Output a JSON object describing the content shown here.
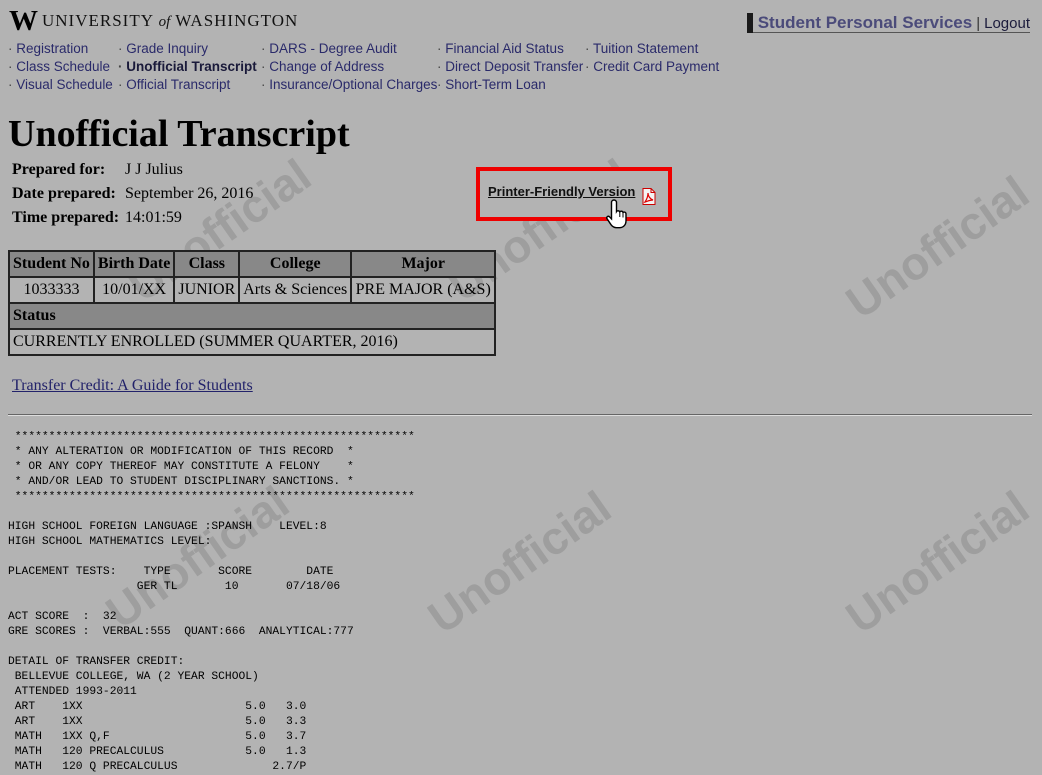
{
  "header": {
    "logo_letter": "W",
    "logo_text_1": "UNIVERSITY",
    "logo_text_of": "of",
    "logo_text_2": "WASHINGTON",
    "app_title": "Student Personal Services",
    "separator": "|",
    "logout_label": "Logout"
  },
  "nav": {
    "col1": [
      "Registration",
      "Class Schedule",
      "Visual Schedule"
    ],
    "col2": [
      "Grade Inquiry",
      "Unofficial Transcript",
      "Official Transcript"
    ],
    "col3": [
      "DARS - Degree Audit",
      "Change of Address",
      "Insurance/Optional Charges"
    ],
    "col4": [
      "Financial Aid Status",
      "Direct Deposit Transfer",
      "Short-Term Loan"
    ],
    "col5": [
      "Tuition Statement",
      "Credit Card Payment"
    ],
    "current": "Unofficial Transcript"
  },
  "page": {
    "title": "Unofficial Transcript",
    "prepared_for_label": "Prepared for:",
    "prepared_for": "J J Julius",
    "date_label": "Date prepared:",
    "date": "September 26, 2016",
    "time_label": "Time prepared:",
    "time": "14:01:59",
    "printer_link": "Printer-Friendly Version",
    "guide_link": "Transfer Credit: A Guide for Students",
    "watermark": "Unofficial"
  },
  "student_table": {
    "headers": [
      "Student No",
      "Birth Date",
      "Class",
      "College",
      "Major"
    ],
    "row": [
      "1033333",
      "10/01/XX",
      "JUNIOR",
      "Arts & Sciences",
      "PRE MAJOR (A&S)"
    ],
    "status_label": "Status",
    "status_value": "CURRENTLY ENROLLED (SUMMER QUARTER, 2016)"
  },
  "transcript_text": " ***********************************************************\n * ANY ALTERATION OR MODIFICATION OF THIS RECORD  *\n * OR ANY COPY THEREOF MAY CONSTITUTE A FELONY    *\n * AND/OR LEAD TO STUDENT DISCIPLINARY SANCTIONS. *\n ***********************************************************\n\nHIGH SCHOOL FOREIGN LANGUAGE :SPANSH    LEVEL:8\nHIGH SCHOOL MATHEMATICS LEVEL:\n\nPLACEMENT TESTS:    TYPE       SCORE        DATE\n                   GER TL       10       07/18/06\n\nACT SCORE  :  32\nGRE SCORES :  VERBAL:555  QUANT:666  ANALYTICAL:777\n\nDETAIL OF TRANSFER CREDIT:\n BELLEVUE COLLEGE, WA (2 YEAR SCHOOL)\n ATTENDED 1993-2011\n ART    1XX                        5.0   3.0\n ART    1XX                        5.0   3.3\n MATH   1XX Q,F                    5.0   3.7\n MATH   120 PRECALCULUS            5.0   1.3\n MATH   120 Q PRECALCULUS              2.7/P",
  "colors": {
    "background": "#b3b3b3",
    "highlight_box": "#ee0000",
    "brand_title": "#4b4b7a"
  }
}
